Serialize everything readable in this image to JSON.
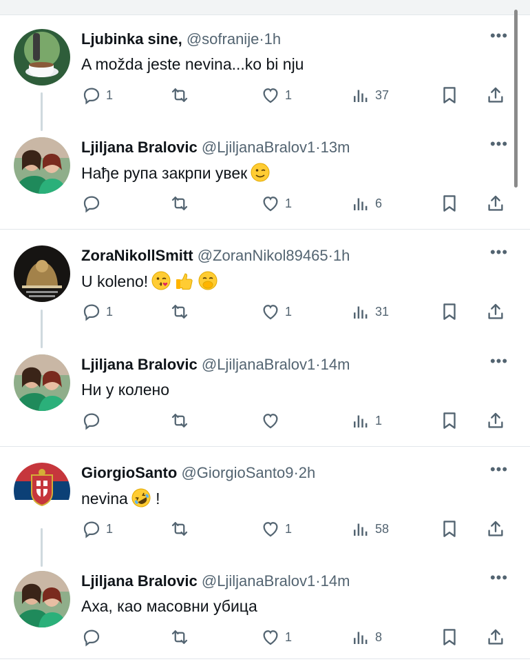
{
  "tweets": [
    {
      "name": "Ljubinka sine,",
      "handle": "@sofranije",
      "time": "1h",
      "text": "A možda jeste nevina...ko bi nju",
      "replies": "1",
      "reposts": "",
      "likes": "1",
      "views": "37",
      "avatar": "teacup-avatar"
    },
    {
      "name": "Ljiljana Bralovic",
      "handle": "@LjiljanaBralov1",
      "time": "13m",
      "text": "Нађе рупа закрпи увек",
      "replies": "",
      "reposts": "",
      "likes": "1",
      "views": "6",
      "avatar": "two-women-avatar"
    },
    {
      "name": "ZoraNikollSmitt",
      "handle": "@ZoranNikol89465",
      "time": "1h",
      "text": "U koleno!",
      "replies": "1",
      "reposts": "",
      "likes": "1",
      "views": "31",
      "avatar": "dark-emblem-avatar"
    },
    {
      "name": "Ljiljana Bralovic",
      "handle": "@LjiljanaBralov1",
      "time": "14m",
      "text": "Ни у колено",
      "replies": "",
      "reposts": "",
      "likes": "",
      "views": "1",
      "avatar": "two-women-avatar"
    },
    {
      "name": "GiorgioSanto",
      "handle": "@GiorgioSanto9",
      "time": "2h",
      "text": "nevina",
      "text_after": "!",
      "replies": "1",
      "reposts": "",
      "likes": "1",
      "views": "58",
      "avatar": "serbian-flag-avatar"
    },
    {
      "name": "Ljiljana Bralovic",
      "handle": "@LjiljanaBralov1",
      "time": "14m",
      "text": "Аха, као масовни убица",
      "replies": "",
      "reposts": "",
      "likes": "1",
      "views": "8",
      "avatar": "two-women-avatar"
    }
  ],
  "separator": "·",
  "more_glyph": "•••",
  "emojis": [
    "winking-face",
    "kissing-face",
    "thumbs-up",
    "hand-over-mouth",
    "rolling-laughing-face"
  ],
  "colors": {
    "text": "#0f1419",
    "secondary": "#536471",
    "divider": "#e1e6ea",
    "connector": "#cfd9de"
  }
}
